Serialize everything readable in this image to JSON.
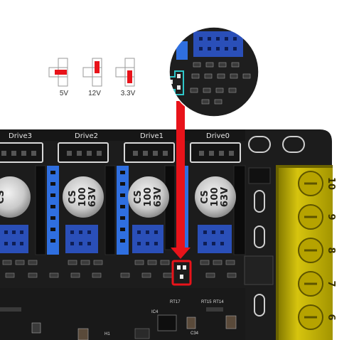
{
  "jumper_legend": [
    {
      "label": "5V"
    },
    {
      "label": "12V"
    },
    {
      "label": "3.3V"
    }
  ],
  "drives": [
    {
      "label": "Drive3"
    },
    {
      "label": "Drive2"
    },
    {
      "label": "Drive1"
    },
    {
      "label": "Drive0"
    }
  ],
  "capacitor_marking": {
    "line1": "CS",
    "line2": "100",
    "line3": "63V"
  },
  "terminal_numbers": [
    "10",
    "9",
    "8",
    "7",
    "6"
  ],
  "silkscreen": [
    "RT17",
    "RT15",
    "RT14",
    "IC4",
    "C34",
    "H1"
  ],
  "colors": {
    "board": "#1c1c1c",
    "header_blue": "#2f6fe0",
    "driver_blue": "#2a4fb8",
    "terminal_yellow": "#d9c400",
    "jumper_red": "#e8131a",
    "arrow_red": "#e8131a",
    "highlight_cyan": "#2ec6c8"
  }
}
